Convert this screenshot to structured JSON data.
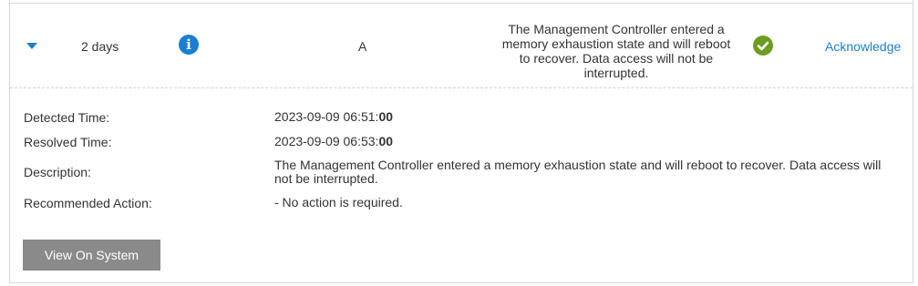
{
  "event": {
    "age": "2 days",
    "source": "A",
    "message": "The Management Controller entered a memory exhaustion state and will reboot to recover. Data access will not be interrupted.",
    "acknowledge_label": "Acknowledge",
    "severity_icon": "info-icon",
    "status_icon": "check-circle-icon",
    "expand_icon": "caret-down-icon"
  },
  "details": {
    "detected_time_label": "Detected Time:",
    "detected_time_prefix": "2023-09-09 06:51:",
    "detected_time_seconds": "00",
    "resolved_time_label": "Resolved Time:",
    "resolved_time_prefix": "2023-09-09 06:53:",
    "resolved_time_seconds": "00",
    "description_label": "Description:",
    "description": "The Management Controller entered a memory exhaustion state and will reboot to recover. Data access will not be interrupted.",
    "recommended_action_label": "Recommended Action:",
    "recommended_action": "- No action is required."
  },
  "actions": {
    "view_on_system_label": "View On System"
  },
  "colors": {
    "accent": "#1a7fd0",
    "ok": "#6b9e1f",
    "button": "#8a8a8a"
  }
}
